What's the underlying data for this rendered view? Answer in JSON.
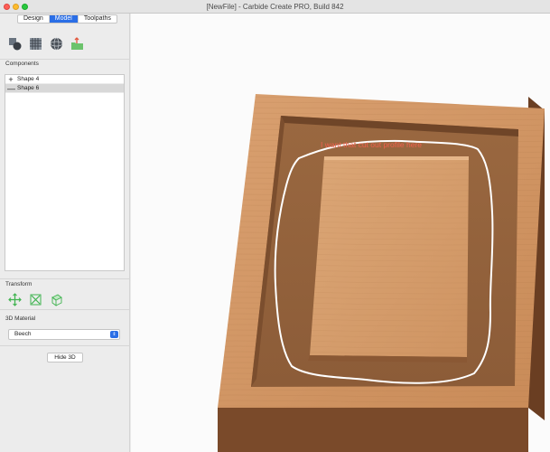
{
  "window": {
    "title": "[NewFile] - Carbide Create PRO, Build 842"
  },
  "tabs": [
    {
      "label": "Design",
      "active": false
    },
    {
      "label": "Model",
      "active": true
    },
    {
      "label": "Toolpaths",
      "active": false
    }
  ],
  "toolbar": {
    "icons": [
      "shape-from-vector-icon",
      "texture-pattern-icon",
      "sphere-icon",
      "import-model-icon"
    ]
  },
  "components": {
    "label": "Components",
    "items": [
      {
        "sign": "+",
        "label": "Shape 4",
        "selected": false
      },
      {
        "sign": "—",
        "label": "Shape 6",
        "selected": true
      }
    ]
  },
  "transform": {
    "label": "Transform",
    "icons": [
      "move-icon",
      "scale-icon",
      "rotate-icon"
    ]
  },
  "material": {
    "label": "3D Material",
    "selected": "Beech"
  },
  "hide_button": {
    "label": "Hide 3D"
  },
  "annotation": {
    "text": "I want that cut out profile here",
    "color": "#f0604e"
  },
  "colors": {
    "accent": "#2a6ee6",
    "wood_light": "#d9a070",
    "wood_dark": "#8a5a36",
    "outline": "#ffffff"
  }
}
